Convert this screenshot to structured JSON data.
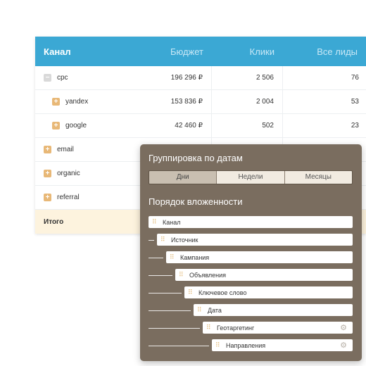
{
  "table": {
    "headers": [
      "Канал",
      "Бюджет",
      "Клики",
      "Все лиды"
    ],
    "rows": [
      {
        "name": "cpc",
        "toggle": "−",
        "budget": "196 296 ₽",
        "clicks": "2 506",
        "leads": "76"
      },
      {
        "name": "yandex",
        "toggle": "+",
        "budget": "153 836 ₽",
        "clicks": "2 004",
        "leads": "53"
      },
      {
        "name": "google",
        "toggle": "+",
        "budget": "42 460 ₽",
        "clicks": "502",
        "leads": "23"
      },
      {
        "name": "email",
        "toggle": "+",
        "budget": "",
        "clicks": "",
        "leads": ""
      },
      {
        "name": "organic",
        "toggle": "+",
        "budget": "",
        "clicks": "",
        "leads": ""
      },
      {
        "name": "referral",
        "toggle": "+",
        "budget": "",
        "clicks": "",
        "leads": ""
      }
    ],
    "total_label": "Итого"
  },
  "panel": {
    "date_grouping_title": "Группировка по датам",
    "date_options": [
      "Дни",
      "Недели",
      "Месяцы"
    ],
    "active_date_option": "Дни",
    "nesting_title": "Порядок вложенности",
    "nesting_items": [
      {
        "label": "Канал",
        "gear": false
      },
      {
        "label": "Источник",
        "gear": false
      },
      {
        "label": "Кампания",
        "gear": false
      },
      {
        "label": "Объявления",
        "gear": false
      },
      {
        "label": "Ключевое слово",
        "gear": false
      },
      {
        "label": "Дата",
        "gear": false
      },
      {
        "label": "Геотаргетинг",
        "gear": true
      },
      {
        "label": "Направления",
        "gear": true
      }
    ]
  },
  "colors": {
    "header_blue": "#3ba8d4",
    "panel_brown": "#7a6d5f",
    "total_row": "#fdf3de",
    "toggle_orange": "#e8b877"
  },
  "icons": {
    "expand": "plus-square-icon",
    "collapse": "minus-square-icon",
    "drag": "drag-handle-icon",
    "settings": "gear-icon"
  }
}
